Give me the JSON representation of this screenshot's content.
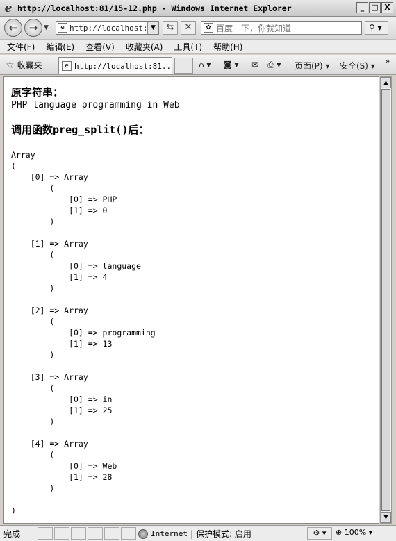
{
  "window": {
    "title": "http://localhost:81/15-12.php - Windows Internet Explorer",
    "minimize": "_",
    "maximize": "□",
    "close": "X"
  },
  "address": {
    "url": "http://localhost:81/15-12.php",
    "search_placeholder": "百度一下，你就知道"
  },
  "menu": [
    "文件(F)",
    "编辑(E)",
    "查看(V)",
    "收藏夹(A)",
    "工具(T)",
    "帮助(H)"
  ],
  "favorites": {
    "label": "收藏夹"
  },
  "tab": {
    "label": "http://localhost:81..."
  },
  "commands": {
    "page": "页面(P)",
    "safety": "安全(S)"
  },
  "content": {
    "original_heading": "原字符串：",
    "original_string": "PHP language programming in Web",
    "split_heading_prefix": "调用函数",
    "split_heading_fn": "preg_split()",
    "split_heading_suffix": "后：",
    "output": "Array\n(\n    [0] => Array\n        (\n            [0] => PHP\n            [1] => 0\n        )\n\n    [1] => Array\n        (\n            [0] => language\n            [1] => 4\n        )\n\n    [2] => Array\n        (\n            [0] => programming\n            [1] => 13\n        )\n\n    [3] => Array\n        (\n            [0] => in\n            [1] => 25\n        )\n\n    [4] => Array\n        (\n            [0] => Web\n            [1] => 28\n        )\n\n)"
  },
  "status": {
    "text": "完成",
    "zone": "Internet",
    "protected_mode": "保护模式: 启用",
    "zoom": "100%"
  }
}
